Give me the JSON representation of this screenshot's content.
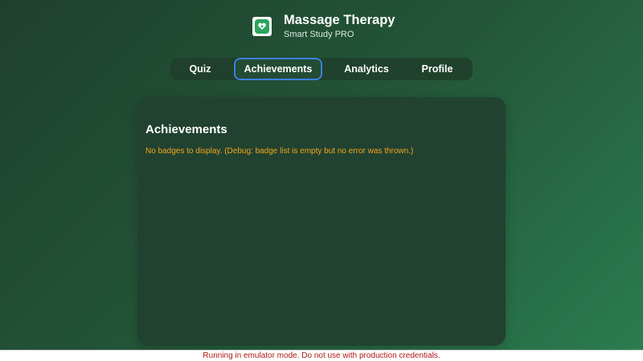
{
  "app": {
    "title": "Massage Therapy",
    "subtitle": "Smart Study PRO",
    "icon": "heart-hands-icon"
  },
  "tabs": [
    {
      "label": "Quiz",
      "active": false
    },
    {
      "label": "Achievements",
      "active": true
    },
    {
      "label": "Analytics",
      "active": false
    },
    {
      "label": "Profile",
      "active": false
    }
  ],
  "panel": {
    "title": "Achievements",
    "message": "No badges to display. (Debug: badge list is empty but no error was thrown.)"
  },
  "statusbar": {
    "text": "Running in emulator mode. Do not use with production credentials."
  },
  "colors": {
    "accent": "#3d7fe0",
    "warning": "#f2a51f",
    "danger": "#b01818",
    "panel": "#214230"
  }
}
